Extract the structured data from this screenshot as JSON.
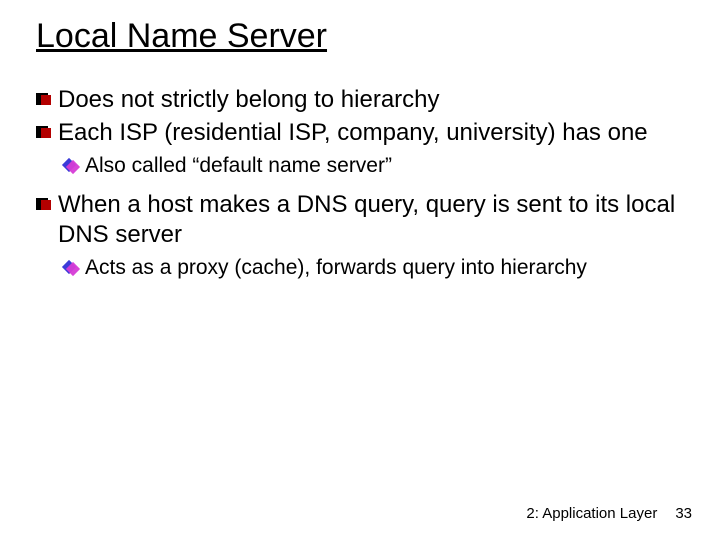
{
  "title": "Local Name Server",
  "bullets": {
    "b1": "Does not strictly belong to hierarchy",
    "b2": "Each ISP (residential ISP, company, university) has one",
    "b2a": "Also called “default name server”",
    "b3": "When a host makes a DNS query, query is sent to its local DNS server",
    "b3a": "Acts as a proxy (cache), forwards query into hierarchy"
  },
  "footer": {
    "section": "2: Application Layer",
    "page": "33"
  }
}
